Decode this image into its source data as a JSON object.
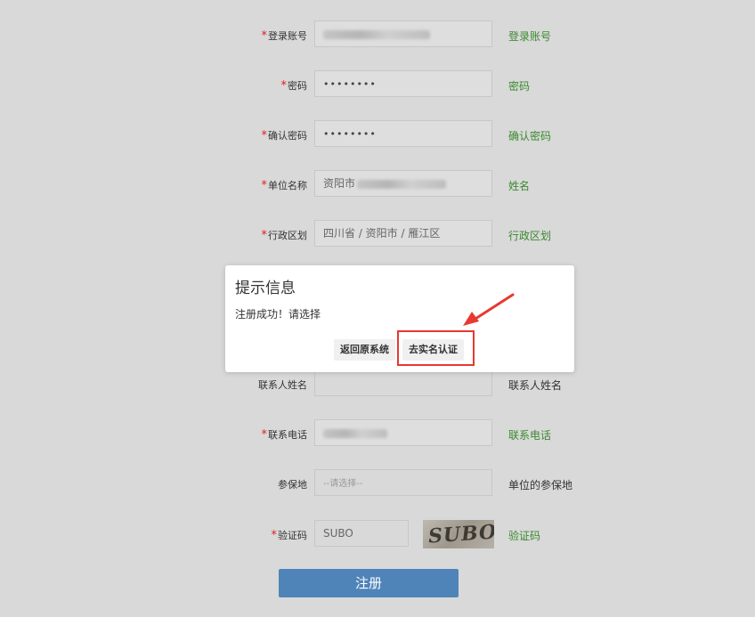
{
  "form": {
    "rows": [
      {
        "label": "登录账号",
        "required": true,
        "type": "blur",
        "blur_width": 120,
        "hint": "登录账号",
        "hint_style": "green"
      },
      {
        "label": "密码",
        "required": true,
        "type": "password",
        "value": "••••••••",
        "hint": "密码",
        "hint_style": "green"
      },
      {
        "label": "确认密码",
        "required": true,
        "type": "password",
        "value": "••••••••",
        "hint": "确认密码",
        "hint_style": "green"
      },
      {
        "label": "单位名称",
        "required": true,
        "type": "text_blur",
        "value": "资阳市",
        "blur_width": 100,
        "hint": "姓名",
        "hint_style": "green"
      },
      {
        "label": "行政区划",
        "required": true,
        "type": "text",
        "value": "四川省 / 资阳市 / 雁江区",
        "hint": "行政区划",
        "hint_style": "green"
      },
      {
        "label": "联系人姓名",
        "required": false,
        "type": "empty",
        "hint": "联系人姓名",
        "hint_style": "dark"
      },
      {
        "label": "联系电话",
        "required": true,
        "type": "blur",
        "blur_width": 72,
        "hint": "联系电话",
        "hint_style": "green"
      },
      {
        "label": "参保地",
        "required": false,
        "type": "select",
        "value": "--请选择--",
        "hint": "单位的参保地",
        "hint_style": "dark"
      },
      {
        "label": "验证码",
        "required": true,
        "type": "captcha",
        "value": "SUBO",
        "captcha_text": "SUBO",
        "hint": "验证码",
        "hint_style": "green"
      }
    ],
    "submit_label": "注册"
  },
  "dialog": {
    "title": "提示信息",
    "message": "注册成功！请选择",
    "buttons": {
      "back": "返回原系统",
      "verify": "去实名认证"
    }
  },
  "colors": {
    "background": "#d9d9d9",
    "hint_green": "#3a8a2e",
    "required_red": "#e02020",
    "submit_blue": "#4f84b9",
    "annotation_red": "#e8392f"
  }
}
